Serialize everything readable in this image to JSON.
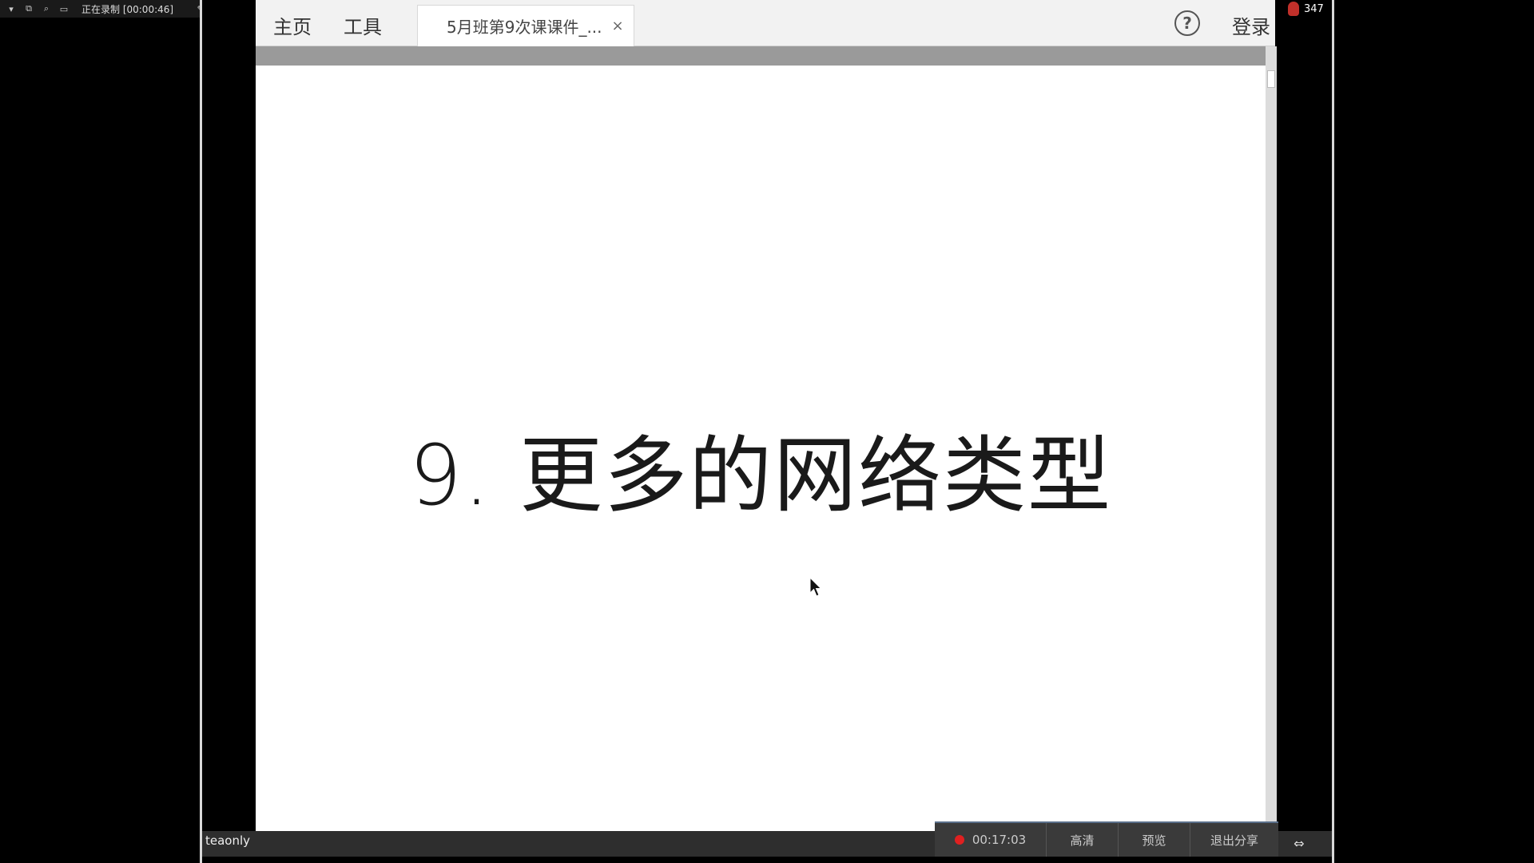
{
  "recorder": {
    "status": "正在录制 [00:00:46]"
  },
  "tabbar": {
    "home_label": "主页",
    "tools_label": "工具",
    "doc_tab_label": "5月班第9次课课件_...",
    "close_glyph": "×",
    "help_glyph": "?",
    "login_label": "登录"
  },
  "notify": {
    "count": "347"
  },
  "slide": {
    "title": "9. 更多的网络类型"
  },
  "bottom_bar": {
    "user_name": "teaonly",
    "timer": "00:17:03",
    "hd_label": "高清",
    "preview_label": "预览",
    "exit_label": "退出分享",
    "expand_glyph": "⇔"
  },
  "colors": {
    "record_red": "#e02020",
    "share_accent": "#5a6f8a"
  },
  "icons": [
    "dropdown-icon",
    "window-icon",
    "zoom-icon",
    "region-icon",
    "pen-icon",
    "pause-icon",
    "stop-icon",
    "camera-icon",
    "close-icon",
    "help-icon",
    "notify-icon",
    "cursor-icon",
    "expand-icon"
  ]
}
